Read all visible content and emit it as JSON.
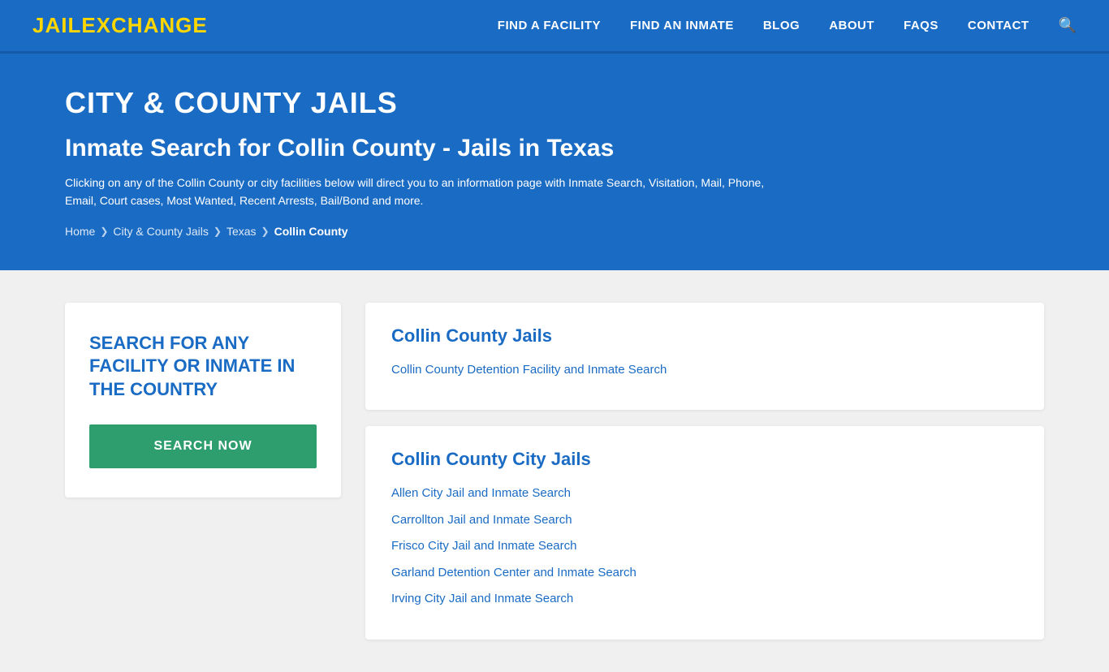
{
  "nav": {
    "logo_part1": "JAIL",
    "logo_part2": "EXCHANGE",
    "links": [
      {
        "label": "FIND A FACILITY",
        "name": "find-facility"
      },
      {
        "label": "FIND AN INMATE",
        "name": "find-inmate"
      },
      {
        "label": "BLOG",
        "name": "blog"
      },
      {
        "label": "ABOUT",
        "name": "about"
      },
      {
        "label": "FAQs",
        "name": "faqs"
      },
      {
        "label": "CONTACT",
        "name": "contact"
      }
    ]
  },
  "hero": {
    "category": "CITY & COUNTY JAILS",
    "title": "Inmate Search for Collin County - Jails in Texas",
    "description": "Clicking on any of the Collin County or city facilities below will direct you to an information page with Inmate Search, Visitation, Mail, Phone, Email, Court cases, Most Wanted, Recent Arrests, Bail/Bond and more.",
    "breadcrumb": {
      "home": "Home",
      "city_county": "City & County Jails",
      "state": "Texas",
      "current": "Collin County"
    }
  },
  "left_panel": {
    "promo_text": "SEARCH FOR ANY FACILITY OR INMATE IN THE COUNTRY",
    "button_label": "SEARCH NOW"
  },
  "county_jails": {
    "title": "Collin County Jails",
    "links": [
      {
        "label": "Collin County Detention Facility and Inmate Search",
        "name": "collin-county-detention"
      }
    ]
  },
  "city_jails": {
    "title": "Collin County City Jails",
    "links": [
      {
        "label": "Allen City Jail and Inmate Search",
        "name": "allen-city-jail"
      },
      {
        "label": "Carrollton Jail and Inmate Search",
        "name": "carrollton-jail"
      },
      {
        "label": "Frisco City Jail and Inmate Search",
        "name": "frisco-city-jail"
      },
      {
        "label": "Garland Detention Center and Inmate Search",
        "name": "garland-detention"
      },
      {
        "label": "Irving City Jail and Inmate Search",
        "name": "irving-city-jail"
      }
    ]
  }
}
